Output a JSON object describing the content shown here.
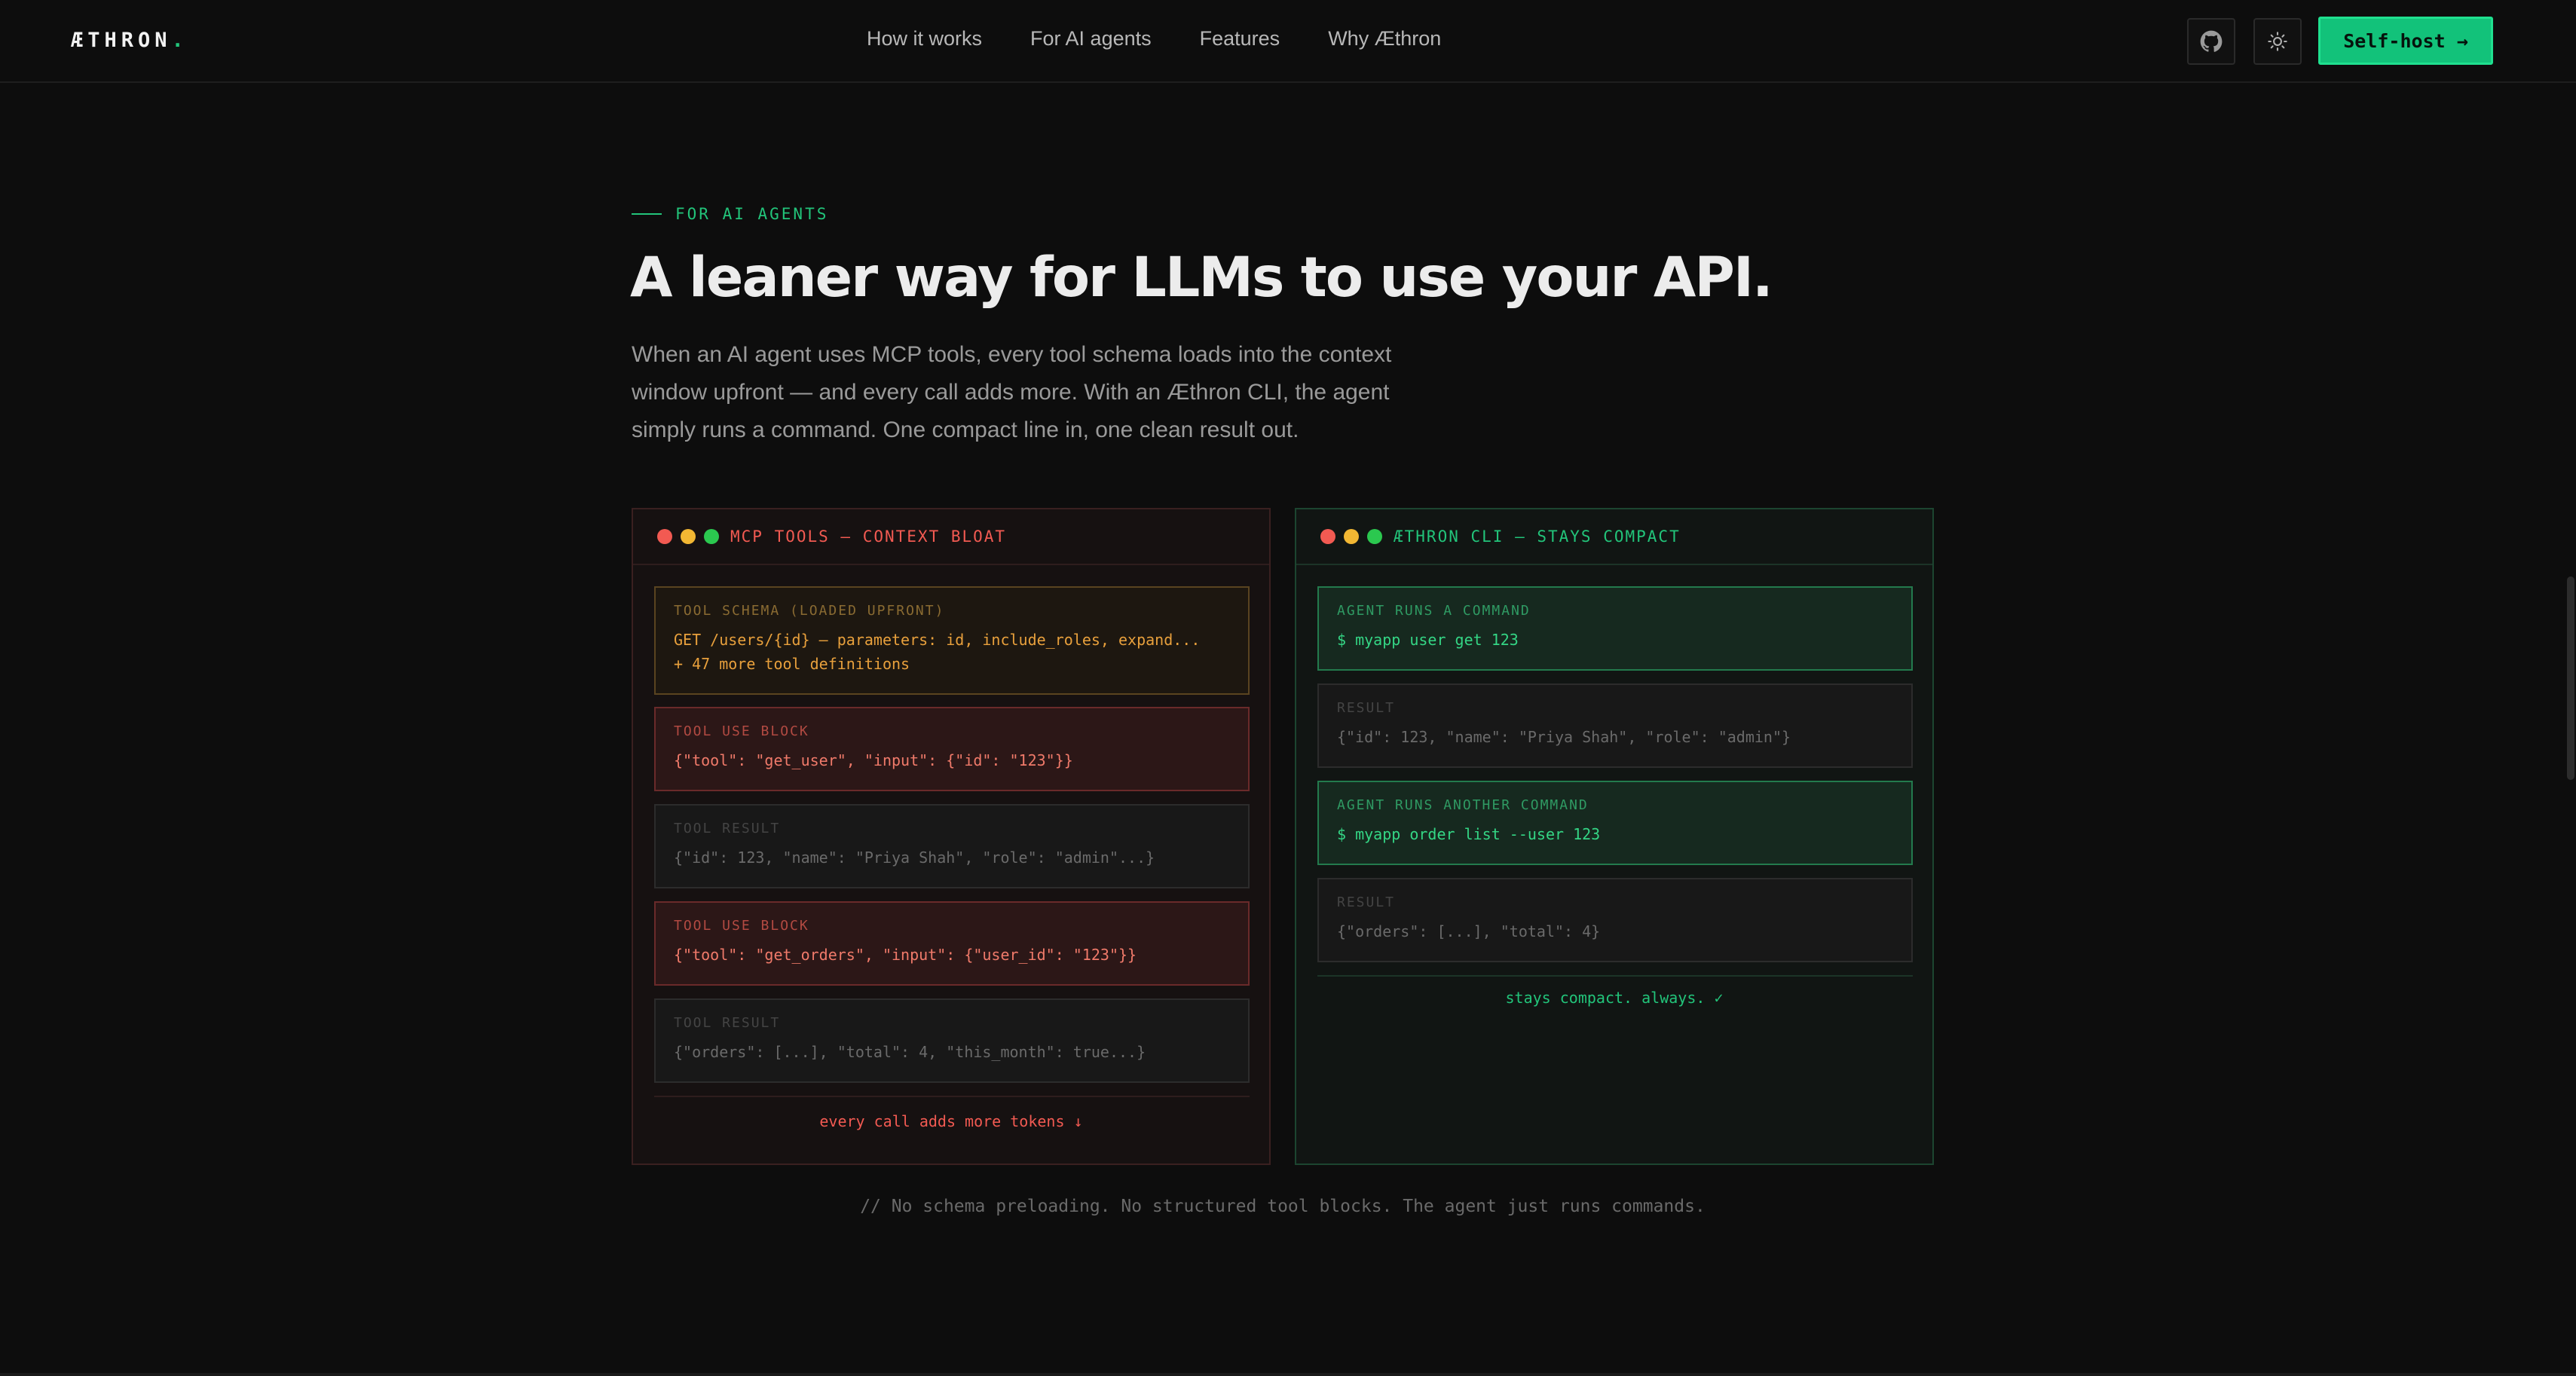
{
  "nav": {
    "logo_text": "ÆTHRON",
    "logo_dot": ".",
    "links": [
      "How it works",
      "For AI agents",
      "Features",
      "Why Æthron"
    ],
    "github_icon": "github-icon",
    "theme_icon": "sun-icon",
    "cta_label": "Self-host →"
  },
  "hero": {
    "eyebrow": "FOR AI AGENTS",
    "headline": "A leaner way for LLMs to use your API.",
    "lead": "When an AI agent uses MCP tools, every tool schema loads into the context window upfront — and every call adds more. With an Æthron CLI, the agent simply runs a command. One compact line in, one clean result out."
  },
  "left_panel": {
    "title": "MCP TOOLS — CONTEXT BLOAT",
    "blocks": [
      {
        "label": "TOOL SCHEMA (LOADED UPFRONT)",
        "code": "GET /users/{id} — parameters: id, include_roles, expand...\n+ 47 more tool definitions"
      },
      {
        "label": "TOOL USE BLOCK",
        "code": "{\"tool\": \"get_user\", \"input\": {\"id\": \"123\"}}"
      },
      {
        "label": "TOOL RESULT",
        "code": "{\"id\": 123, \"name\": \"Priya Shah\", \"role\": \"admin\"...}"
      },
      {
        "label": "TOOL USE BLOCK",
        "code": "{\"tool\": \"get_orders\", \"input\": {\"user_id\": \"123\"}}"
      },
      {
        "label": "TOOL RESULT",
        "code": "{\"orders\": [...], \"total\": 4, \"this_month\": true...}"
      }
    ],
    "footnote": "every call adds more tokens ↓"
  },
  "right_panel": {
    "title": "ÆTHRON CLI — STAYS COMPACT",
    "blocks": [
      {
        "label": "AGENT RUNS A COMMAND",
        "code": "$ myapp user get 123"
      },
      {
        "label": "RESULT",
        "code": "{\"id\": 123, \"name\": \"Priya Shah\", \"role\": \"admin\"}"
      },
      {
        "label": "AGENT RUNS ANOTHER COMMAND",
        "code": "$ myapp order list --user 123"
      },
      {
        "label": "RESULT",
        "code": "{\"orders\": [...], \"total\": 4}"
      }
    ],
    "footnote": "stays compact. always. ✓"
  },
  "bottom_note": "// No schema preloading. No structured tool blocks. The agent just runs commands.",
  "colors": {
    "accent": "#22c47a",
    "danger": "#f25a52",
    "warning": "#e8a03c",
    "background": "#0d0d0d"
  }
}
